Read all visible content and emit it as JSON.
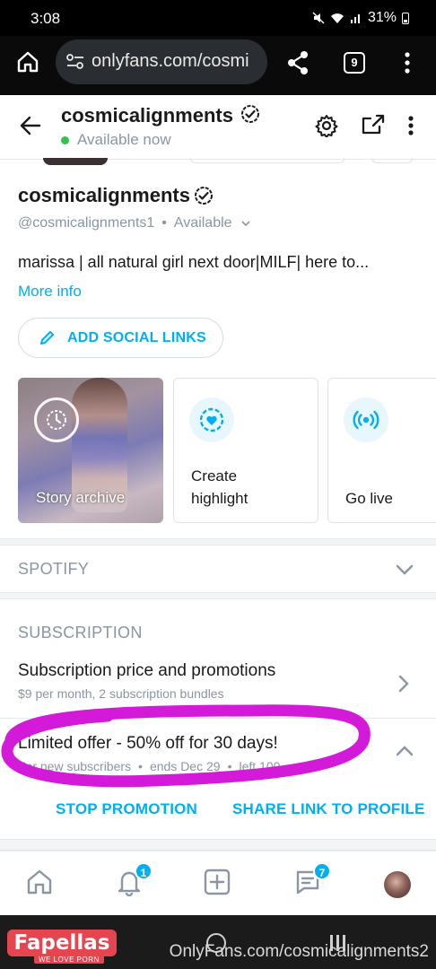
{
  "status_bar": {
    "time": "3:08",
    "battery": "31%"
  },
  "browser": {
    "url": "onlyfans.com/cosmi",
    "tab_count": "9"
  },
  "header": {
    "title": "cosmicalignments",
    "status": "Available now"
  },
  "profile": {
    "name": "cosmicalignments",
    "handle": "@cosmicalignments1",
    "separator": "•",
    "availability": "Available",
    "bio": "marissa | all natural girl next door|MILF| here to...",
    "more_info": "More info",
    "add_social_links": "ADD SOCIAL LINKS"
  },
  "cards": {
    "story_archive": "Story archive",
    "create_highlight_line1": "Create",
    "create_highlight_line2": "highlight",
    "go_live": "Go live"
  },
  "spotify": {
    "title": "SPOTIFY"
  },
  "subscription": {
    "title": "SUBSCRIPTION",
    "price_title": "Subscription price and promotions",
    "price_subtitle": "$9 per month, 2 subscription bundles",
    "offer_title": "Limited offer - 50% off for 30 days!",
    "offer_audience": "For new subscribers",
    "offer_separator": "•",
    "offer_ends": "ends Dec 29",
    "offer_left": "left 100",
    "stop_promotion": "STOP PROMOTION",
    "share_link": "SHARE LINK TO PROFILE"
  },
  "bottom_nav": {
    "notifications_count": "1",
    "messages_count": "7"
  },
  "watermark": {
    "logo": "Fapellas",
    "tagline": "WE LOVE PORN",
    "url": "OnlyFans.com/cosmicalignments2"
  },
  "colors": {
    "accent": "#00aff0",
    "muted": "#8a96a3",
    "online": "#32c24d",
    "annotation": "#d21ad8"
  }
}
